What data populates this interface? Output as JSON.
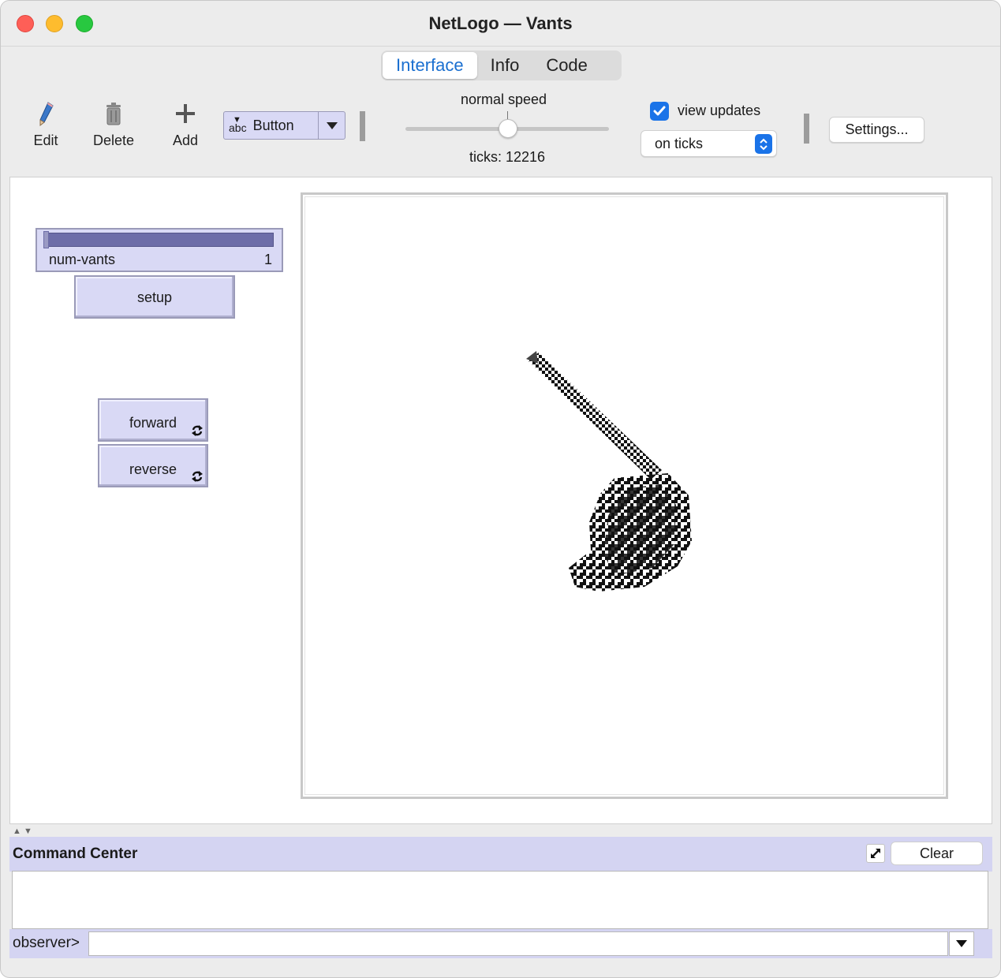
{
  "window": {
    "title": "NetLogo — Vants"
  },
  "tabs": [
    {
      "label": "Interface",
      "active": true
    },
    {
      "label": "Info",
      "active": false
    },
    {
      "label": "Code",
      "active": false
    }
  ],
  "toolbar": {
    "edit_label": "Edit",
    "delete_label": "Delete",
    "add_label": "Add",
    "widget_type": "Button",
    "speed_label": "normal speed",
    "speed_value": 0.5,
    "ticks_label": "ticks: 12216",
    "view_updates_label": "view updates",
    "view_updates_checked": true,
    "update_mode": "on ticks",
    "settings_label": "Settings..."
  },
  "widgets": {
    "num_vants": {
      "name": "num-vants",
      "value": "1"
    },
    "setup": {
      "label": "setup"
    },
    "forward": {
      "label": "forward",
      "forever": true
    },
    "reverse": {
      "label": "reverse",
      "forever": true
    }
  },
  "command_center": {
    "title": "Command Center",
    "clear_label": "Clear",
    "prompt": "observer>",
    "input_value": ""
  },
  "colors": {
    "widget_fill": "#d9d9f5",
    "accent": "#1a73e8",
    "tab_active": "#1a6fd0",
    "command_center_bg": "#d4d4f2"
  }
}
